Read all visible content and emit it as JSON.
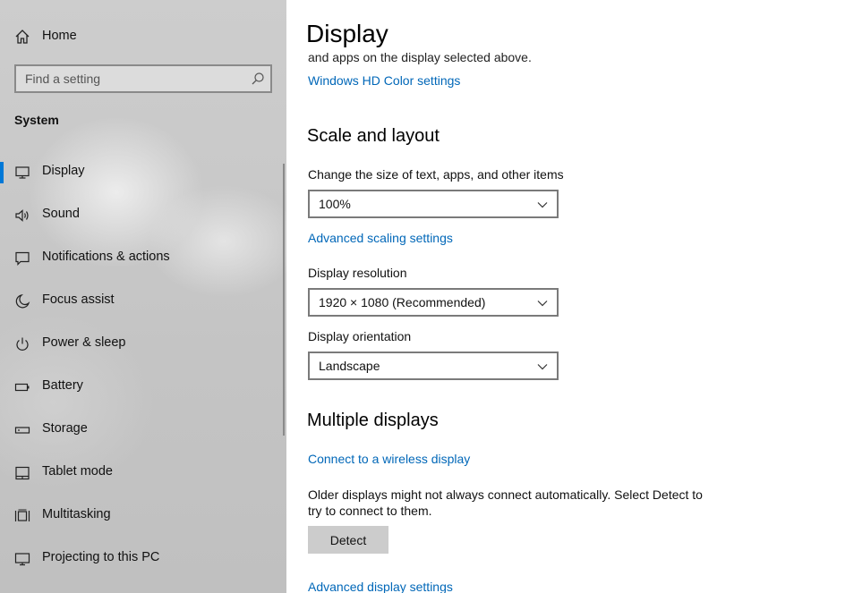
{
  "sidebar": {
    "home_label": "Home",
    "search_placeholder": "Find a setting",
    "section_title": "System",
    "items": [
      {
        "label": "Display",
        "icon": "monitor-icon",
        "active": true
      },
      {
        "label": "Sound",
        "icon": "speaker-icon"
      },
      {
        "label": "Notifications & actions",
        "icon": "notification-icon"
      },
      {
        "label": "Focus assist",
        "icon": "moon-icon"
      },
      {
        "label": "Power & sleep",
        "icon": "power-icon"
      },
      {
        "label": "Battery",
        "icon": "battery-icon"
      },
      {
        "label": "Storage",
        "icon": "storage-icon"
      },
      {
        "label": "Tablet mode",
        "icon": "tablet-icon"
      },
      {
        "label": "Multitasking",
        "icon": "multitasking-icon"
      },
      {
        "label": "Projecting to this PC",
        "icon": "projector-icon"
      }
    ]
  },
  "main": {
    "title": "Display",
    "clipped_text": "and apps on the display selected above.",
    "hd_color_link": "Windows HD Color settings",
    "scale_heading": "Scale and layout",
    "scale_label": "Change the size of text, apps, and other items",
    "scale_value": "100%",
    "advanced_scaling_link": "Advanced scaling settings",
    "resolution_label": "Display resolution",
    "resolution_value": "1920 × 1080 (Recommended)",
    "orientation_label": "Display orientation",
    "orientation_value": "Landscape",
    "multiple_heading": "Multiple displays",
    "wireless_link": "Connect to a wireless display",
    "older_text": "Older displays might not always connect automatically. Select Detect to try to connect to them.",
    "detect_button": "Detect",
    "advanced_display_link": "Advanced display settings"
  },
  "colors": {
    "accent": "#0078d7",
    "link": "#0067b8"
  }
}
